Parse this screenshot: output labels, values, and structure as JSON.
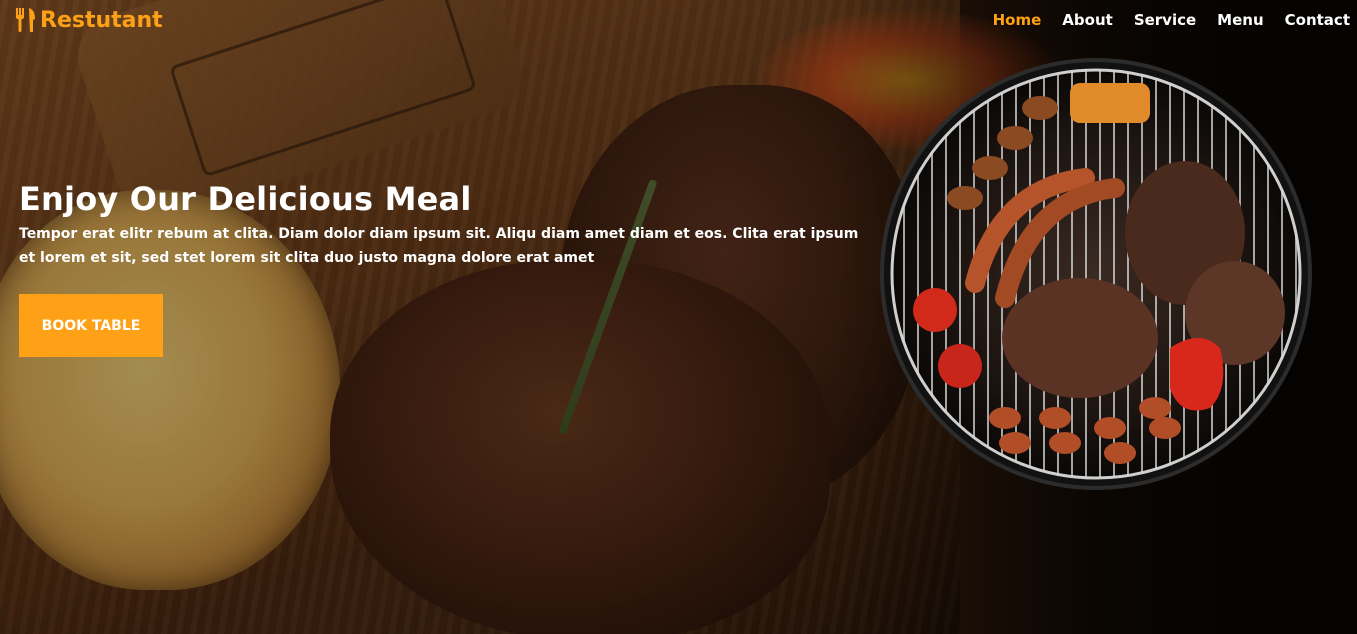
{
  "brand": {
    "name": "Restutant",
    "icon": "utensils-icon",
    "color": "#fea116"
  },
  "nav": {
    "items": [
      {
        "label": "Home",
        "active": true
      },
      {
        "label": "About",
        "active": false
      },
      {
        "label": "Service",
        "active": false
      },
      {
        "label": "Menu",
        "active": false
      },
      {
        "label": "Contact",
        "active": false
      }
    ]
  },
  "hero": {
    "title": "Enjoy Our Delicious Meal",
    "description": "Tempor erat elitr rebum at clita. Diam dolor diam ipsum sit. Aliqu diam amet diam et eos. Clita erat ipsum et lorem et sit, sed stet lorem sit clita duo justo magna dolore erat amet",
    "button_label": "BOOK TABLE"
  },
  "colors": {
    "accent": "#fea116",
    "text": "#ffffff"
  }
}
